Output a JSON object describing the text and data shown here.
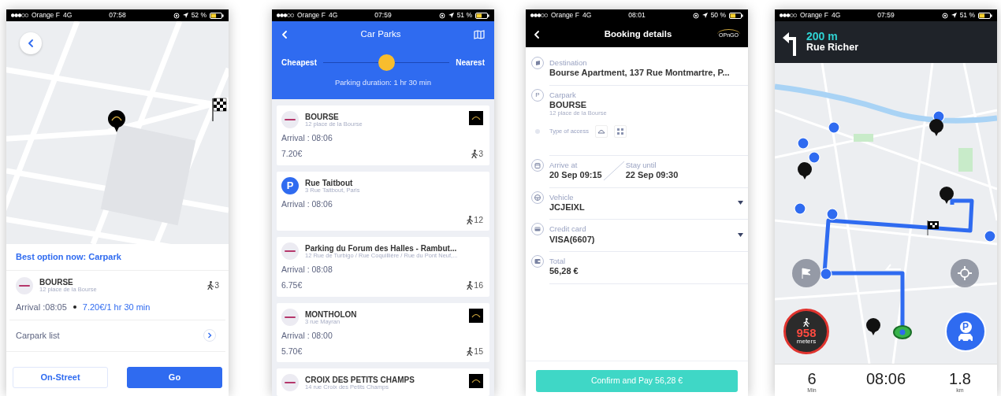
{
  "screens": [
    {
      "kind": "map_summary",
      "status": {
        "carrier": "Orange F",
        "network": "4G",
        "time": "07:58",
        "battery": "52 %"
      },
      "best_option": "Best option now: Carpark",
      "carpark": {
        "name": "BOURSE",
        "address": "12 place de la Bourse",
        "walk": "3",
        "arrival": "Arrival :08:05",
        "price": "7.20€/1 hr 30 min"
      },
      "list_link": "Carpark list",
      "buttons": [
        {
          "label": "On-Street",
          "primary": false
        },
        {
          "label": "Go",
          "primary": true
        }
      ]
    },
    {
      "kind": "list",
      "status": {
        "carrier": "Orange F",
        "network": "4G",
        "time": "07:59",
        "battery": "51 %"
      },
      "title": "Car Parks",
      "slider": {
        "left": "Cheapest",
        "right": "Nearest",
        "level": 0.5
      },
      "duration": "Parking duration: 1 hr 30 min",
      "cards": [
        {
          "name": "BOURSE",
          "address": "12 place de la Bourse",
          "arrival": "Arrival : 08:06",
          "price": "7.20€",
          "walk": "3",
          "badge": true
        },
        {
          "logo_letter": "P",
          "name": "Rue Taitbout",
          "address": "3 Rue Taitbout, Paris",
          "arrival": "Arrival : 08:06",
          "walk": "12",
          "badge": false
        },
        {
          "name": "Parking du Forum des Halles - Rambut...",
          "address": "12 Rue de Turbigo / Rue Coquillière / Rue du Pont Neuf,...",
          "arrival": "Arrival : 08:08",
          "price": "6.75€",
          "walk": "16",
          "badge": false
        },
        {
          "name": "MONTHOLON",
          "address": "3 rue Mayran",
          "arrival": "Arrival : 08:00",
          "price": "5.70€",
          "walk": "15",
          "badge": true
        },
        {
          "name": "CROIX DES PETITS CHAMPS",
          "address": "14 rue Croix des Petits Champs",
          "badge": true
        }
      ]
    },
    {
      "kind": "booking",
      "status": {
        "carrier": "Orange F",
        "network": "4G",
        "time": "08:01",
        "battery": "50 %"
      },
      "title": "Booking details",
      "brand": "OPnGO",
      "rows": [
        {
          "kind": "field",
          "label": "Destination",
          "value": "Bourse Apartment, 137 Rue Montmartre, P...",
          "dropdown": false
        },
        {
          "kind": "carpark",
          "icon_letter": "P",
          "label": "Carpark",
          "value": "BOURSE",
          "address": "12 place de la Bourse",
          "access_label": "Type of access"
        },
        {
          "kind": "dates",
          "label": "Arrive at",
          "value": "20 Sep 09:15",
          "label_2": "Stay until",
          "value_2": "22 Sep 09:30"
        },
        {
          "kind": "field",
          "label": "Vehicle",
          "value": "JCJEIXL",
          "dropdown": true
        },
        {
          "kind": "field",
          "label": "Credit card",
          "value": "VISA(6607)",
          "dropdown": true
        },
        {
          "kind": "field",
          "label": "Total",
          "value": "56,28 €",
          "dropdown": false
        }
      ],
      "confirm": "Confirm and Pay 56,28 €"
    },
    {
      "kind": "navigation",
      "status": {
        "carrier": "Orange F",
        "network": "4G",
        "time": "07:59",
        "battery": "51 %"
      },
      "distance": "200 m",
      "street": "Rue Richer",
      "walk_badge": {
        "value": "958",
        "unit": "meters"
      },
      "parking_letter": "P",
      "stats": [
        {
          "value": "6",
          "unit": "Min"
        },
        {
          "value": "08:06"
        },
        {
          "value": "1.8",
          "unit": "km"
        }
      ]
    }
  ]
}
